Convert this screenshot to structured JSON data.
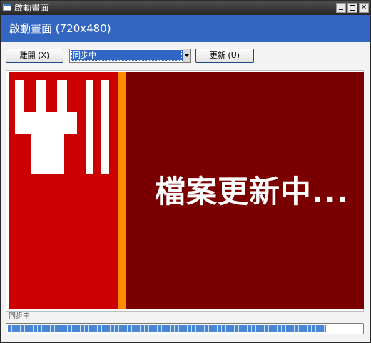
{
  "window": {
    "title": "啟動畫面",
    "controls": [
      "minimize-icon",
      "maximize-icon",
      "close-icon"
    ]
  },
  "header": {
    "title": "啟動畫面 (720x480)"
  },
  "toolbar": {
    "leave_label": "離開 (X)",
    "mode_select": {
      "selected": "同步中"
    },
    "update_label": "更新 (U)"
  },
  "splash": {
    "message": "檔案更新中...",
    "logo_icon": "fork-logo",
    "colors": {
      "panel_left": "#cc0000",
      "stripe": "#ff8c00",
      "background": "#7a0000",
      "text": "#ffffff"
    }
  },
  "status": {
    "text": "同步中"
  },
  "progress": {
    "fraction": 0.9
  },
  "colors": {
    "header_bg": "#3366c0",
    "selection": "#3166c4",
    "progress": "#4a86d6"
  }
}
